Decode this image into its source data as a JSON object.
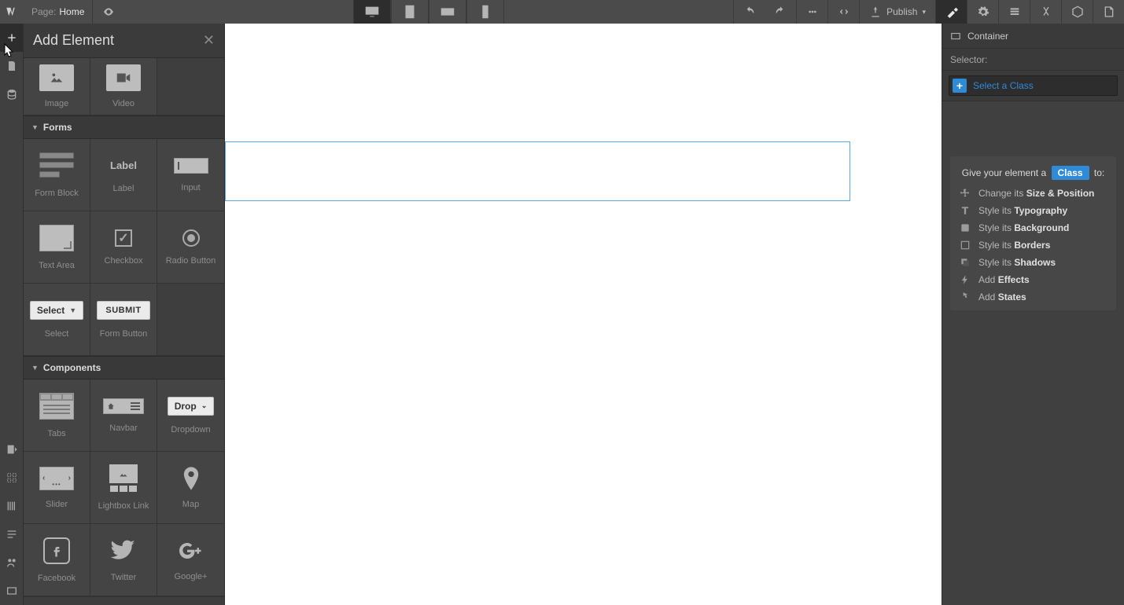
{
  "topbar": {
    "page_label": "Page:",
    "page_name": "Home",
    "publish_label": "Publish"
  },
  "add_panel": {
    "title": "Add Element",
    "media": {
      "image": "Image",
      "video": "Video"
    },
    "sections": {
      "forms": "Forms",
      "components": "Components"
    },
    "forms": {
      "form_block": "Form Block",
      "label": "Label",
      "label_glyph": "Label",
      "input": "Input",
      "textarea": "Text Area",
      "checkbox": "Checkbox",
      "radio": "Radio Button",
      "select": "Select",
      "select_glyph": "Select",
      "form_button": "Form Button",
      "submit_glyph": "SUBMIT"
    },
    "components": {
      "tabs": "Tabs",
      "navbar": "Navbar",
      "dropdown": "Dropdown",
      "dropdown_glyph": "Drop",
      "slider": "Slider",
      "lightbox": "Lightbox Link",
      "map": "Map",
      "facebook": "Facebook",
      "twitter": "Twitter",
      "google": "Google+"
    }
  },
  "right": {
    "breadcrumb": "Container",
    "selector_label": "Selector:",
    "select_class_ph": "Select a Class",
    "hint_lead_pre": "Give your element a",
    "hint_lead_chip": "Class",
    "hint_lead_post": "to:",
    "hints": {
      "hint0_pre": "Change its ",
      "hint0_b": "Size & Position",
      "hint1_pre": "Style its ",
      "hint1_b": "Typography",
      "hint2_pre": "Style its ",
      "hint2_b": "Background",
      "hint3_pre": "Style its ",
      "hint3_b": "Borders",
      "hint4_pre": "Style its ",
      "hint4_b": "Shadows",
      "hint5_pre": "Add ",
      "hint5_b": "Effects",
      "hint6_pre": "Add ",
      "hint6_b": "States"
    }
  }
}
